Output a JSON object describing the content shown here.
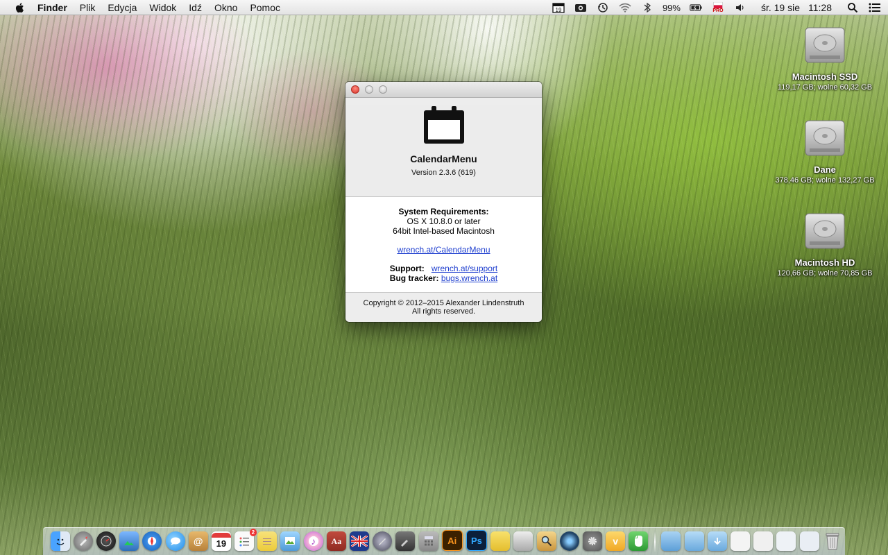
{
  "menubar": {
    "app_name": "Finder",
    "items": [
      "Plik",
      "Edycja",
      "Widok",
      "Idź",
      "Okno",
      "Pomoc"
    ],
    "tray": {
      "calendar_day": "19",
      "battery": "99%",
      "flag_label": "PRO",
      "date": "śr. 19 sie",
      "time": "11:28"
    }
  },
  "drives": [
    {
      "name": "Macintosh SSD",
      "info": "119,17 GB; wolne 60,32 GB"
    },
    {
      "name": "Dane",
      "info": "378,46 GB; wolne 132,27 GB"
    },
    {
      "name": "Macintosh HD",
      "info": "120,66 GB; wolne 70,85 GB"
    }
  ],
  "about": {
    "app_name": "CalendarMenu",
    "version": "Version 2.3.6 (619)",
    "requirements_title": "System Requirements:",
    "requirements": [
      "OS X 10.8.0 or later",
      "64bit Intel-based Macintosh"
    ],
    "homepage": "wrench.at/CalendarMenu",
    "support_label": "Support:",
    "support_link": "wrench.at/support",
    "bugtracker_label": "Bug tracker:",
    "bugtracker_link": "bugs.wrench.at",
    "copyright": "Copyright ©  2012–2015 Alexander Lindenstruth",
    "rights": "All rights reserved."
  },
  "dock": {
    "calendar_day": "19",
    "reminders_badge": "2",
    "illustrator_label": "Ai",
    "photoshop_label": "Ps",
    "dictionary_label": "Aa"
  },
  "colors": {
    "link": "#1f3fcf",
    "close_button": "#d9352b",
    "illustrator_bg": "#3b2100",
    "photoshop_bg": "#0b1f3a"
  }
}
